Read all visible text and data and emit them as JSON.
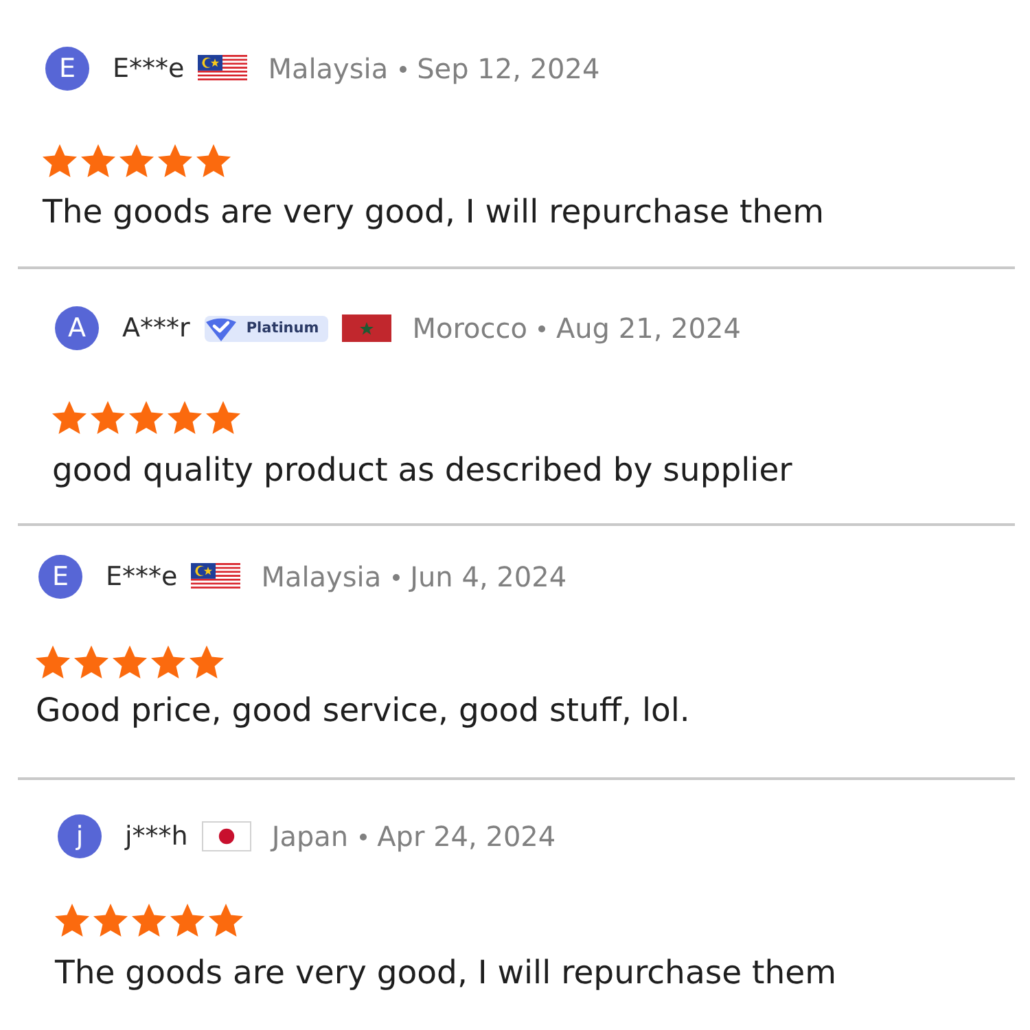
{
  "reviews": [
    {
      "avatar": "E",
      "name": "E***e",
      "flag": {
        "kind": "malaysia"
      },
      "country": "Malaysia",
      "date": "Sep 12, 2024",
      "stars": 5,
      "text": "The goods are very good, I will repurchase them"
    },
    {
      "avatar": "A",
      "name": "A***r",
      "badge": {
        "label": "Platinum"
      },
      "flag": {
        "kind": "morocco"
      },
      "country": "Morocco",
      "date": "Aug 21, 2024",
      "stars": 5,
      "text": "good quality product as described by supplier"
    },
    {
      "avatar": "E",
      "name": "E***e",
      "flag": {
        "kind": "malaysia"
      },
      "country": "Malaysia",
      "date": "Jun 4, 2024",
      "stars": 5,
      "text": "Good price, good service, good stuff, lol."
    },
    {
      "avatar": "j",
      "name": "j***h",
      "flag": {
        "kind": "japan"
      },
      "country": "Japan",
      "date": "Apr 24, 2024",
      "stars": 5,
      "text": "The goods are very good, I will repurchase them"
    }
  ]
}
